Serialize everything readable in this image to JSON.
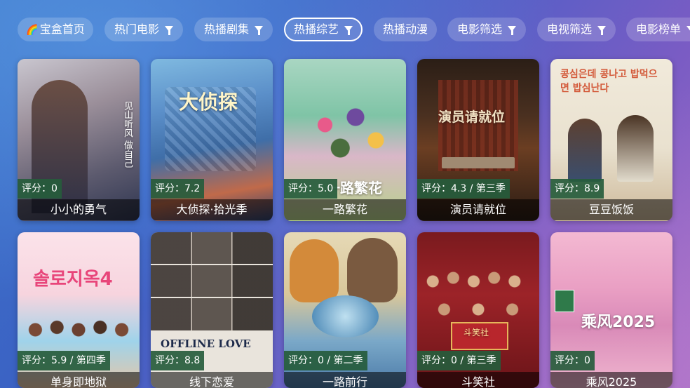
{
  "nav": {
    "tabs": [
      {
        "label": "宝盒首页",
        "rainbow": true,
        "filter": false
      },
      {
        "label": "热门电影",
        "filter": true
      },
      {
        "label": "热播剧集",
        "filter": true
      },
      {
        "label": "热播综艺",
        "filter": true,
        "active": true
      },
      {
        "label": "热播动漫",
        "filter": false
      },
      {
        "label": "电影筛选",
        "filter": true
      },
      {
        "label": "电视筛选",
        "filter": true
      },
      {
        "label": "电影榜单",
        "filter": true
      }
    ]
  },
  "cards": [
    {
      "title": "小小的勇气",
      "rating": "评分：0",
      "poster_text": "见山听风 做自己"
    },
    {
      "title": "大侦探·拾光季",
      "rating": "评分：7.2",
      "poster_text": "大侦探"
    },
    {
      "title": "一路繁花",
      "rating": "评分：5.0",
      "poster_text": "一路繁花"
    },
    {
      "title": "演员请就位",
      "rating": "评分：4.3 / 第三季",
      "poster_text": "演员请就位"
    },
    {
      "title": "豆豆饭饭",
      "rating": "评分：8.9",
      "poster_text": "콩심은데 콩나고 밥먹으면 밥심난다"
    },
    {
      "title": "单身即地狱",
      "rating": "评分：5.9 / 第四季",
      "poster_text": "솔로지옥4"
    },
    {
      "title": "线下恋爱",
      "rating": "评分：8.8",
      "poster_text": "OFFLINE LOVE"
    },
    {
      "title": "一路前行",
      "rating": "评分：0 / 第二季",
      "poster_text": ""
    },
    {
      "title": "斗笑社",
      "rating": "评分：0 / 第三季",
      "poster_text": "斗笑社"
    },
    {
      "title": "乘风2025",
      "rating": "评分：0",
      "poster_text": "乘风2025"
    }
  ],
  "colors": {
    "rating_bg": "#265c3c",
    "accent": "#ffffff"
  }
}
